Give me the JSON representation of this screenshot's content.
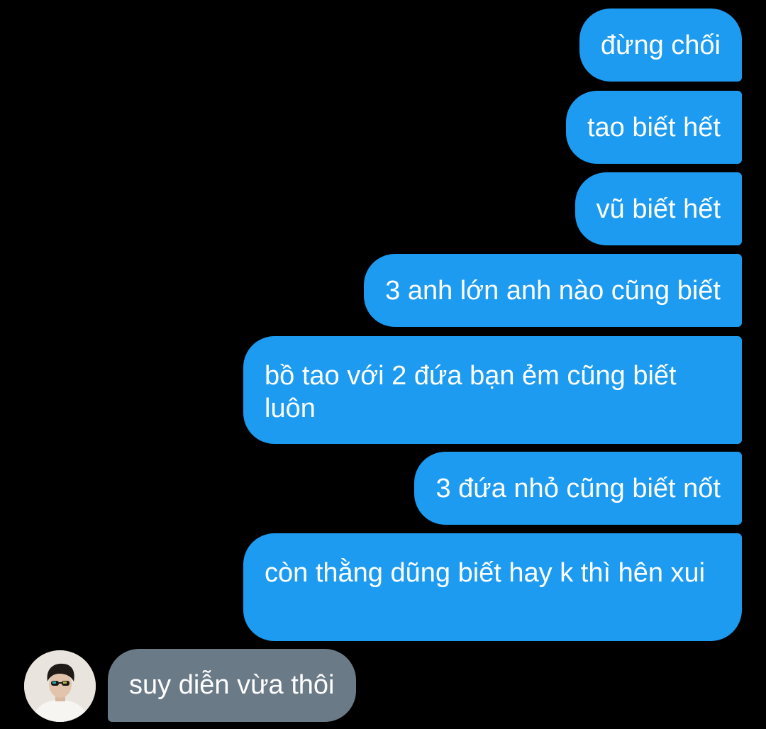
{
  "messages": {
    "sent": [
      "đừng chối",
      "tao biết hết",
      "vũ biết hết",
      "3 anh lớn anh nào cũng biết",
      "bồ tao với 2 đứa bạn ẻm cũng biết luôn",
      "3 đứa nhỏ cũng biết nốt",
      "còn thằng dũng biết hay k thì hên xui"
    ],
    "received": [
      "suy diễn vừa thôi"
    ]
  },
  "colors": {
    "background": "#000000",
    "sent_bubble": "#1d9bf0",
    "received_bubble": "#6b7a87",
    "text": "#ffffff"
  },
  "icons": {
    "avatar": "user-avatar-photo"
  }
}
